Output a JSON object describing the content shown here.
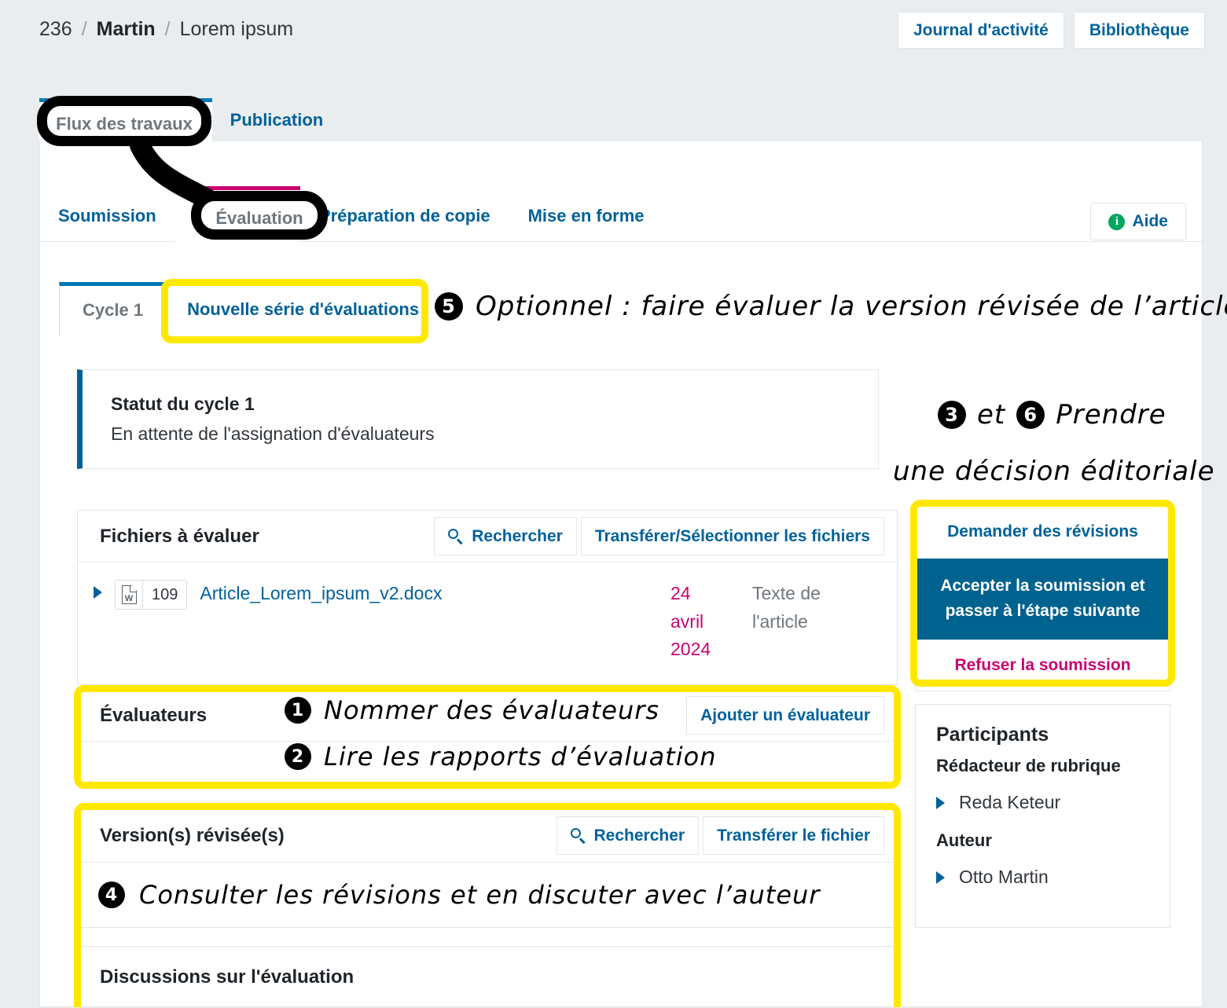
{
  "breadcrumb": {
    "id": "236",
    "author": "Martin",
    "title": "Lorem ipsum",
    "separator": "/"
  },
  "header": {
    "activity_log_label": "Journal d'activité",
    "library_label": "Bibliothèque"
  },
  "primary_tabs": [
    {
      "label": "Flux des travaux",
      "active": true
    },
    {
      "label": "Publication",
      "active": false
    }
  ],
  "stage_tabs": [
    {
      "label": "Soumission",
      "active": false
    },
    {
      "label": "Évaluation",
      "active": true
    },
    {
      "label": "Préparation de copie",
      "active": false
    },
    {
      "label": "Mise en forme",
      "active": false
    }
  ],
  "help": {
    "label": "Aide",
    "icon": "info-icon",
    "icon_glyph": "i",
    "icon_color": "#00a65e"
  },
  "round_tabs": [
    {
      "label": "Cycle 1",
      "active": true
    },
    {
      "label": "Nouvelle série d'évaluations",
      "active": false
    }
  ],
  "status": {
    "title": "Statut du cycle 1",
    "text": "En attente de l'assignation d'évaluateurs"
  },
  "files_card": {
    "title": "Fichiers à évaluer",
    "search_label": "Rechercher",
    "upload_label": "Transférer/Sélectionner les fichiers",
    "rows": [
      {
        "file_icon": "word-document-icon",
        "icon_letter": "W",
        "count": "109",
        "name": "Article_Lorem_ipsum_v2.docx",
        "date": "24 avril 2024",
        "genre": "Texte de l'article"
      }
    ]
  },
  "reviewers_card": {
    "title": "Évaluateurs",
    "add_label": "Ajouter un évaluateur"
  },
  "revisions_card": {
    "title": "Version(s) révisée(s)",
    "search_label": "Rechercher",
    "upload_label": "Transférer le fichier"
  },
  "discussions_card": {
    "title": "Discussions sur l'évaluation"
  },
  "decisions": [
    {
      "label": "Demander des révisions",
      "style": "accept"
    },
    {
      "label": "Accepter la soumission et passer à l'étape suivante",
      "style": "primary"
    },
    {
      "label": "Refuser la soumission",
      "style": "decline"
    }
  ],
  "participants": {
    "title": "Participants",
    "groups": [
      {
        "role": "Rédacteur de rubrique",
        "people": [
          "Reda Keteur"
        ]
      },
      {
        "role": "Auteur",
        "people": [
          "Otto Martin"
        ]
      }
    ]
  },
  "annotations": [
    {
      "number": "5",
      "text": "Optionnel : faire évaluer la version révisée de l’article"
    },
    {
      "number": "3",
      "text": "3 et 6 Prendre une décision éditoriale"
    },
    {
      "number": "1",
      "text": "Nommer des évaluateurs"
    },
    {
      "number": "2",
      "text": "Lire les rapports d’évaluation"
    },
    {
      "number": "4",
      "text": "Consulter les révisions et en discuter avec l’auteur"
    }
  ],
  "annotation_parts": {
    "a5_num": "5",
    "a5_text": "Optionnel : faire évaluer la version révisée de l’article",
    "a36_num1": "3",
    "a36_mid": "et",
    "a36_num2": "6",
    "a36_text1": "Prendre",
    "a36_text2": "une décision éditoriale",
    "a1_num": "1",
    "a1_text": "Nommer des évaluateurs",
    "a2_num": "2",
    "a2_text": "Lire les rapports d’évaluation",
    "a4_num": "4",
    "a4_text": "Consulter les révisions et en discuter avec l’auteur"
  },
  "colors": {
    "page_background": "#eaedef",
    "link_blue": "#00619b",
    "primary_button": "#00628f",
    "accent_magenta": "#c8036f",
    "active_tab_blue": "#007ab2",
    "highlight_yellow": "#ffe800",
    "callout_black": "#000000",
    "status_bar_blue": "#00619b",
    "muted_gray": "#6f777d"
  }
}
